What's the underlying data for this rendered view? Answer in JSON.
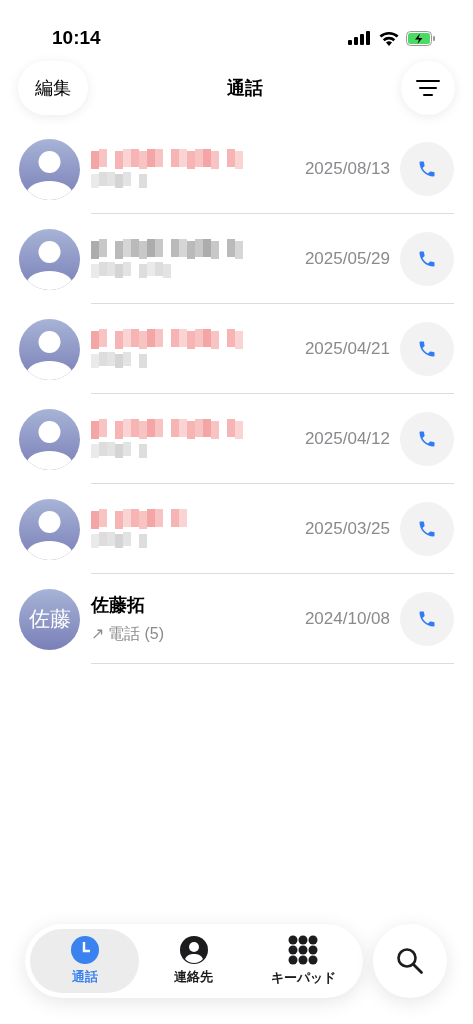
{
  "status_bar": {
    "time": "10:14"
  },
  "header": {
    "edit_button": "編集",
    "title": "通話"
  },
  "calls": [
    {
      "kind": "redacted",
      "missed": true,
      "date": "2025/08/13"
    },
    {
      "kind": "redacted",
      "missed": false,
      "date": "2025/05/29"
    },
    {
      "kind": "redacted",
      "missed": true,
      "date": "2025/04/21"
    },
    {
      "kind": "redacted",
      "missed": true,
      "date": "2025/04/12"
    },
    {
      "kind": "redacted",
      "missed": true,
      "date": "2025/03/25"
    },
    {
      "kind": "contact",
      "missed": false,
      "initials": "佐藤",
      "name": "佐藤拓",
      "direction": "↗",
      "detail": "電話 (5)",
      "date": "2024/10/08"
    }
  ],
  "tab_bar": {
    "tabs": [
      {
        "label": "通話",
        "kind": "clock",
        "selected": true
      },
      {
        "label": "連絡先",
        "kind": "person",
        "selected": false
      },
      {
        "label": "キーパッド",
        "kind": "keypad",
        "selected": false
      }
    ]
  }
}
